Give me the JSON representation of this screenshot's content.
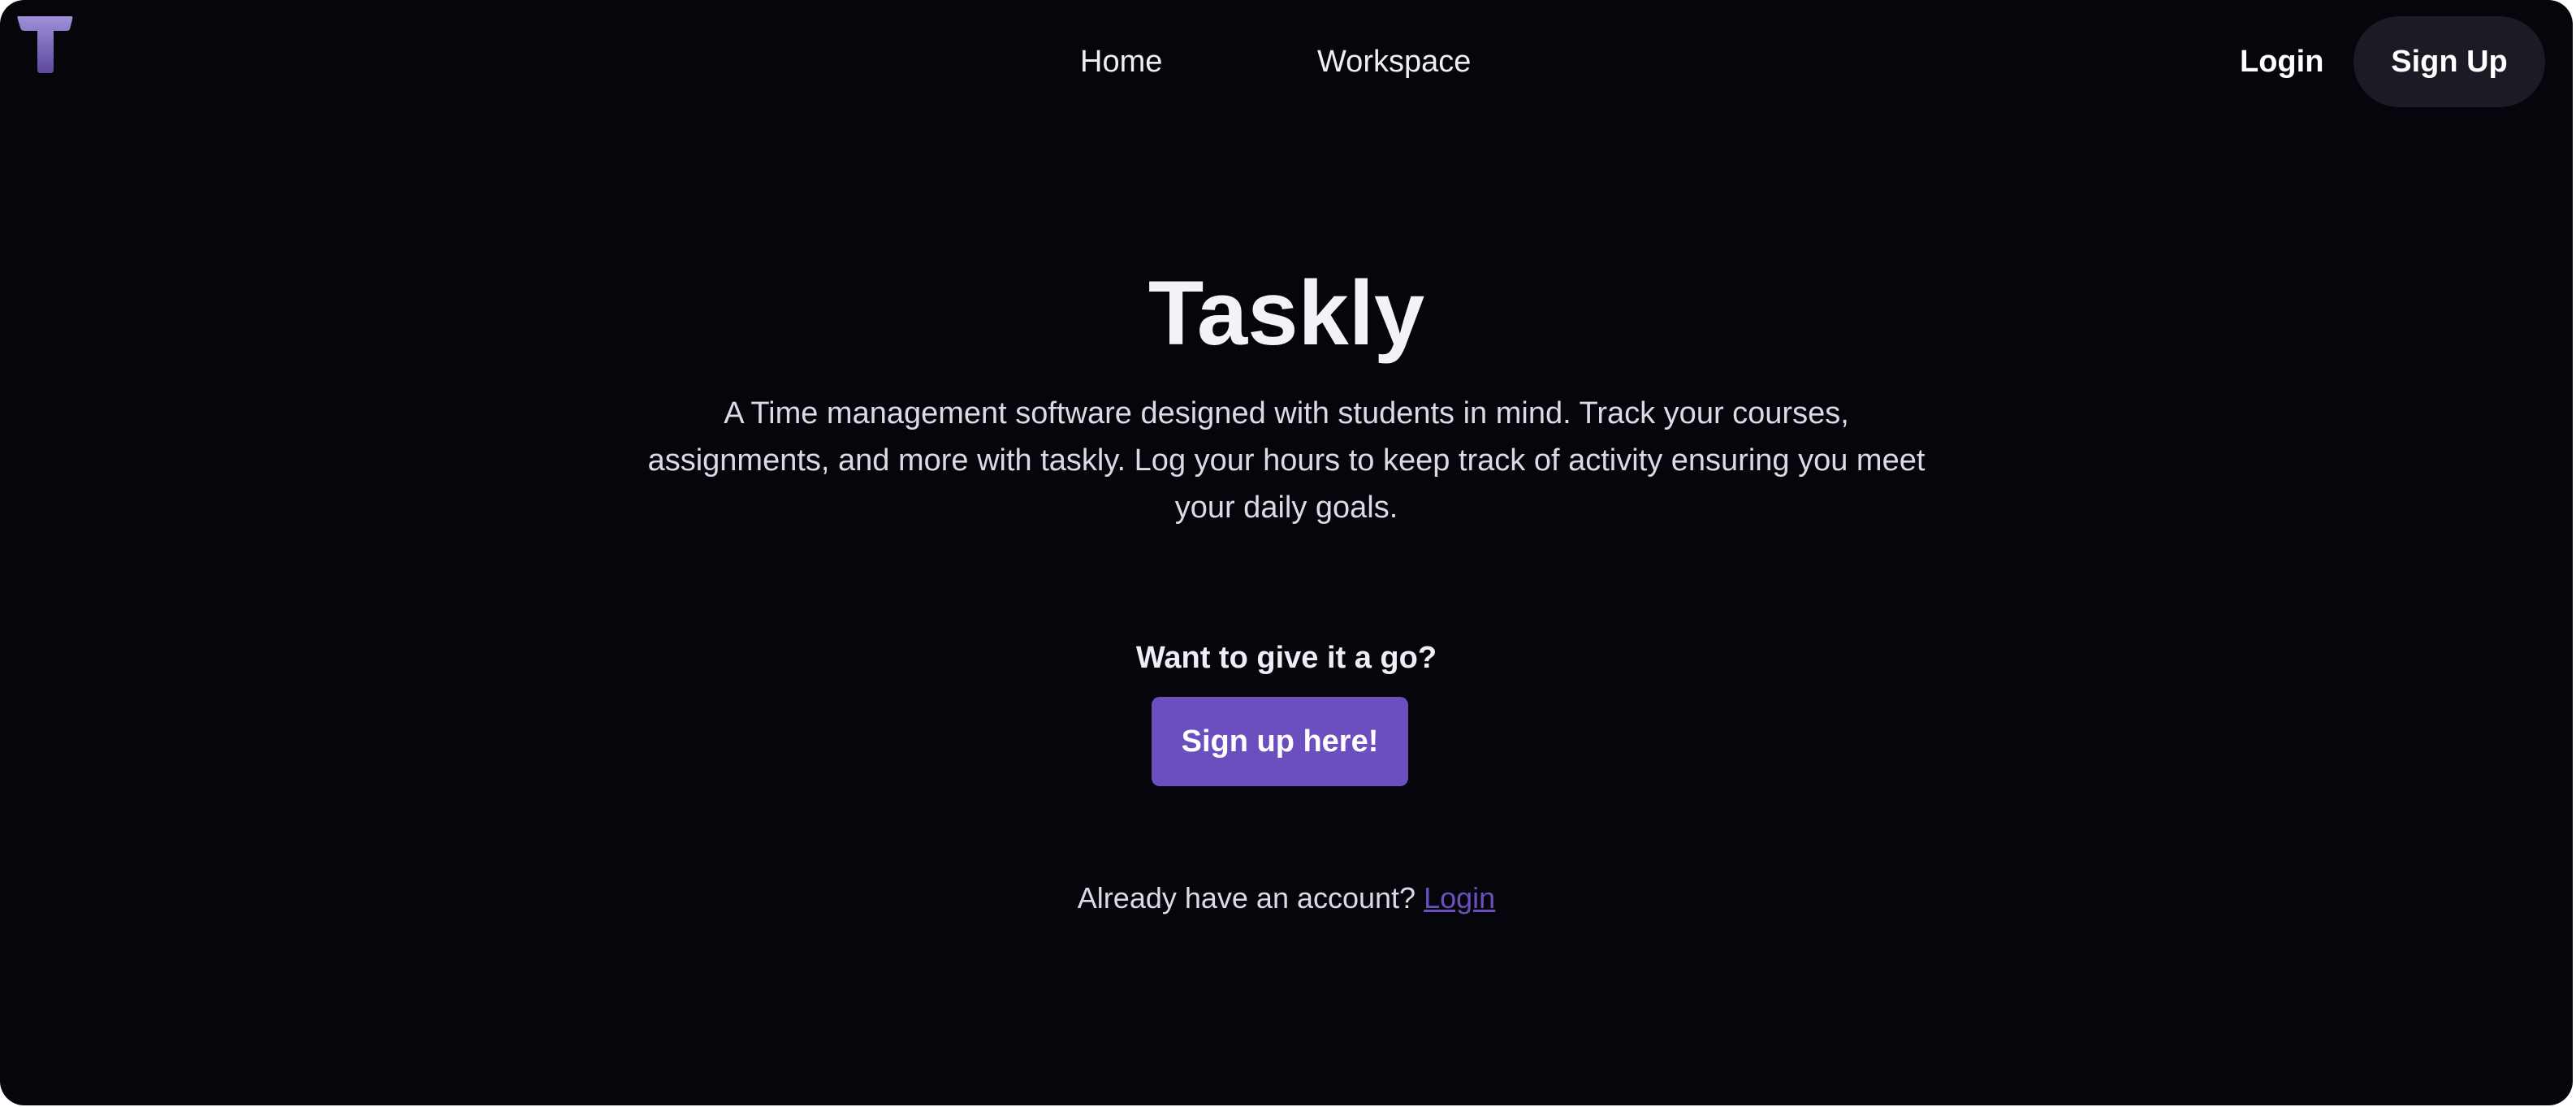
{
  "brand": {
    "logo_icon": "taskly-t-logo-icon",
    "accent_color": "#6b4fbf",
    "background_color": "#06050b"
  },
  "nav": {
    "home": "Home",
    "workspace": "Workspace",
    "login": "Login",
    "signup": "Sign Up"
  },
  "hero": {
    "title": "Taskly",
    "description": "A Time management software designed with students in mind. Track your courses, assignments, and more with taskly. Log your hours to keep track of activity ensuring you meet your daily goals."
  },
  "cta": {
    "prompt": "Want to give it a go?",
    "button": "Sign up here!",
    "already_text": "Already have an account?",
    "login_link": "Login"
  }
}
